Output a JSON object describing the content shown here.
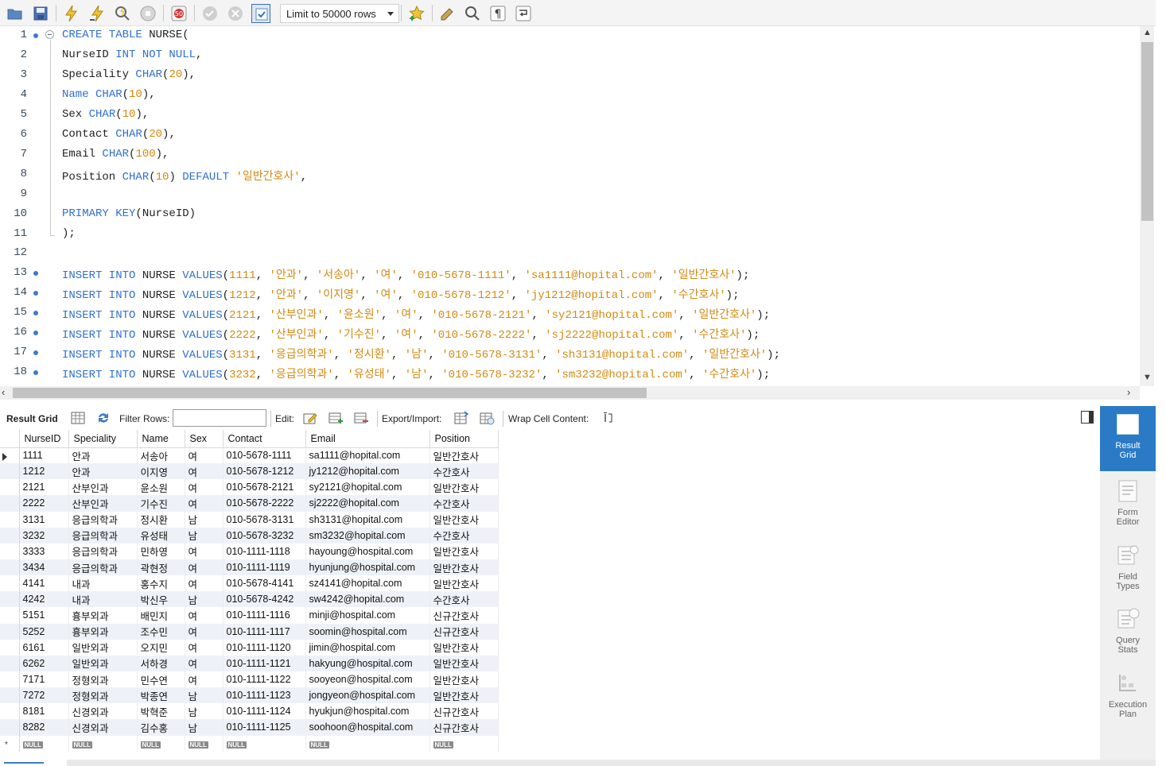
{
  "toolbar": {
    "limit_label": "Limit to 50000 rows",
    "icons": [
      "open-folder-icon",
      "save-icon",
      "execute-icon",
      "execute-current-icon",
      "explain-icon",
      "stop-icon",
      "stop-on-error-icon",
      "commit-icon",
      "rollback-icon",
      "autocommit-icon",
      "beautify-icon",
      "add-snippet-icon",
      "find-icon",
      "invisible-chars-icon",
      "wrap-icon"
    ]
  },
  "editor": {
    "lines": [
      {
        "n": "1",
        "dot": true,
        "tokens": [
          {
            "t": "CREATE TABLE ",
            "c": "kw"
          },
          {
            "t": "NURSE(",
            "c": ""
          }
        ]
      },
      {
        "n": "2",
        "dot": false,
        "tokens": [
          {
            "t": "NurseID ",
            "c": ""
          },
          {
            "t": "INT NOT NULL",
            "c": "kw"
          },
          {
            "t": ",",
            "c": ""
          }
        ]
      },
      {
        "n": "3",
        "dot": false,
        "tokens": [
          {
            "t": "Speciality ",
            "c": ""
          },
          {
            "t": "CHAR",
            "c": "kw"
          },
          {
            "t": "(",
            "c": ""
          },
          {
            "t": "20",
            "c": "num"
          },
          {
            "t": "),",
            "c": ""
          }
        ]
      },
      {
        "n": "4",
        "dot": false,
        "tokens": [
          {
            "t": "Name ",
            "c": "kw"
          },
          {
            "t": "CHAR",
            "c": "kw"
          },
          {
            "t": "(",
            "c": ""
          },
          {
            "t": "10",
            "c": "num"
          },
          {
            "t": "),",
            "c": ""
          }
        ]
      },
      {
        "n": "5",
        "dot": false,
        "tokens": [
          {
            "t": "Sex ",
            "c": ""
          },
          {
            "t": "CHAR",
            "c": "kw"
          },
          {
            "t": "(",
            "c": ""
          },
          {
            "t": "10",
            "c": "num"
          },
          {
            "t": "),",
            "c": ""
          }
        ]
      },
      {
        "n": "6",
        "dot": false,
        "tokens": [
          {
            "t": "Contact ",
            "c": ""
          },
          {
            "t": "CHAR",
            "c": "kw"
          },
          {
            "t": "(",
            "c": ""
          },
          {
            "t": "20",
            "c": "num"
          },
          {
            "t": "),",
            "c": ""
          }
        ]
      },
      {
        "n": "7",
        "dot": false,
        "tokens": [
          {
            "t": "Email ",
            "c": ""
          },
          {
            "t": "CHAR",
            "c": "kw"
          },
          {
            "t": "(",
            "c": ""
          },
          {
            "t": "100",
            "c": "num"
          },
          {
            "t": "),",
            "c": ""
          }
        ]
      },
      {
        "n": "8",
        "dot": false,
        "tokens": [
          {
            "t": "Position ",
            "c": ""
          },
          {
            "t": "CHAR",
            "c": "kw"
          },
          {
            "t": "(",
            "c": ""
          },
          {
            "t": "10",
            "c": "num"
          },
          {
            "t": ") ",
            "c": ""
          },
          {
            "t": "DEFAULT ",
            "c": "kw"
          },
          {
            "t": "'일반간호사'",
            "c": "str"
          },
          {
            "t": ",",
            "c": ""
          }
        ]
      },
      {
        "n": "9",
        "dot": false,
        "tokens": []
      },
      {
        "n": "10",
        "dot": false,
        "tokens": [
          {
            "t": "PRIMARY KEY",
            "c": "kw"
          },
          {
            "t": "(NurseID)",
            "c": ""
          }
        ]
      },
      {
        "n": "11",
        "dot": false,
        "tokens": [
          {
            "t": ");",
            "c": ""
          }
        ]
      },
      {
        "n": "12",
        "dot": false,
        "tokens": []
      },
      {
        "n": "13",
        "dot": true,
        "tokens": [
          {
            "t": "INSERT INTO ",
            "c": "kw"
          },
          {
            "t": "NURSE ",
            "c": ""
          },
          {
            "t": "VALUES",
            "c": "kw"
          },
          {
            "t": "(",
            "c": ""
          },
          {
            "t": "1111",
            "c": "num"
          },
          {
            "t": ", ",
            "c": ""
          },
          {
            "t": "'안과'",
            "c": "str"
          },
          {
            "t": ", ",
            "c": ""
          },
          {
            "t": "'서송아'",
            "c": "str"
          },
          {
            "t": ", ",
            "c": ""
          },
          {
            "t": "'여'",
            "c": "str"
          },
          {
            "t": ", ",
            "c": ""
          },
          {
            "t": "'010-5678-1111'",
            "c": "str"
          },
          {
            "t": ", ",
            "c": ""
          },
          {
            "t": "'sa1111@hopital.com'",
            "c": "str"
          },
          {
            "t": ", ",
            "c": ""
          },
          {
            "t": "'일반간호사'",
            "c": "str"
          },
          {
            "t": ");",
            "c": ""
          }
        ]
      },
      {
        "n": "14",
        "dot": true,
        "tokens": [
          {
            "t": "INSERT INTO ",
            "c": "kw"
          },
          {
            "t": "NURSE ",
            "c": ""
          },
          {
            "t": "VALUES",
            "c": "kw"
          },
          {
            "t": "(",
            "c": ""
          },
          {
            "t": "1212",
            "c": "num"
          },
          {
            "t": ", ",
            "c": ""
          },
          {
            "t": "'안과'",
            "c": "str"
          },
          {
            "t": ", ",
            "c": ""
          },
          {
            "t": "'이지영'",
            "c": "str"
          },
          {
            "t": ", ",
            "c": ""
          },
          {
            "t": "'여'",
            "c": "str"
          },
          {
            "t": ", ",
            "c": ""
          },
          {
            "t": "'010-5678-1212'",
            "c": "str"
          },
          {
            "t": ", ",
            "c": ""
          },
          {
            "t": "'jy1212@hopital.com'",
            "c": "str"
          },
          {
            "t": ", ",
            "c": ""
          },
          {
            "t": "'수간호사'",
            "c": "str"
          },
          {
            "t": ");",
            "c": ""
          }
        ]
      },
      {
        "n": "15",
        "dot": true,
        "tokens": [
          {
            "t": "INSERT INTO ",
            "c": "kw"
          },
          {
            "t": "NURSE ",
            "c": ""
          },
          {
            "t": "VALUES",
            "c": "kw"
          },
          {
            "t": "(",
            "c": ""
          },
          {
            "t": "2121",
            "c": "num"
          },
          {
            "t": ", ",
            "c": ""
          },
          {
            "t": "'산부인과'",
            "c": "str"
          },
          {
            "t": ", ",
            "c": ""
          },
          {
            "t": "'윤소원'",
            "c": "str"
          },
          {
            "t": ", ",
            "c": ""
          },
          {
            "t": "'여'",
            "c": "str"
          },
          {
            "t": ", ",
            "c": ""
          },
          {
            "t": "'010-5678-2121'",
            "c": "str"
          },
          {
            "t": ", ",
            "c": ""
          },
          {
            "t": "'sy2121@hopital.com'",
            "c": "str"
          },
          {
            "t": ", ",
            "c": ""
          },
          {
            "t": "'일반간호사'",
            "c": "str"
          },
          {
            "t": ");",
            "c": ""
          }
        ]
      },
      {
        "n": "16",
        "dot": true,
        "tokens": [
          {
            "t": "INSERT INTO ",
            "c": "kw"
          },
          {
            "t": "NURSE ",
            "c": ""
          },
          {
            "t": "VALUES",
            "c": "kw"
          },
          {
            "t": "(",
            "c": ""
          },
          {
            "t": "2222",
            "c": "num"
          },
          {
            "t": ", ",
            "c": ""
          },
          {
            "t": "'산부인과'",
            "c": "str"
          },
          {
            "t": ", ",
            "c": ""
          },
          {
            "t": "'기수진'",
            "c": "str"
          },
          {
            "t": ", ",
            "c": ""
          },
          {
            "t": "'여'",
            "c": "str"
          },
          {
            "t": ", ",
            "c": ""
          },
          {
            "t": "'010-5678-2222'",
            "c": "str"
          },
          {
            "t": ", ",
            "c": ""
          },
          {
            "t": "'sj2222@hopital.com'",
            "c": "str"
          },
          {
            "t": ", ",
            "c": ""
          },
          {
            "t": "'수간호사'",
            "c": "str"
          },
          {
            "t": ");",
            "c": ""
          }
        ]
      },
      {
        "n": "17",
        "dot": true,
        "tokens": [
          {
            "t": "INSERT INTO ",
            "c": "kw"
          },
          {
            "t": "NURSE ",
            "c": ""
          },
          {
            "t": "VALUES",
            "c": "kw"
          },
          {
            "t": "(",
            "c": ""
          },
          {
            "t": "3131",
            "c": "num"
          },
          {
            "t": ", ",
            "c": ""
          },
          {
            "t": "'응급의학과'",
            "c": "str"
          },
          {
            "t": ", ",
            "c": ""
          },
          {
            "t": "'정시환'",
            "c": "str"
          },
          {
            "t": ", ",
            "c": ""
          },
          {
            "t": "'남'",
            "c": "str"
          },
          {
            "t": ", ",
            "c": ""
          },
          {
            "t": "'010-5678-3131'",
            "c": "str"
          },
          {
            "t": ", ",
            "c": ""
          },
          {
            "t": "'sh3131@hopital.com'",
            "c": "str"
          },
          {
            "t": ", ",
            "c": ""
          },
          {
            "t": "'일반간호사'",
            "c": "str"
          },
          {
            "t": ");",
            "c": ""
          }
        ]
      },
      {
        "n": "18",
        "dot": true,
        "tokens": [
          {
            "t": "INSERT INTO ",
            "c": "kw"
          },
          {
            "t": "NURSE ",
            "c": ""
          },
          {
            "t": "VALUES",
            "c": "kw"
          },
          {
            "t": "(",
            "c": ""
          },
          {
            "t": "3232",
            "c": "num"
          },
          {
            "t": ", ",
            "c": ""
          },
          {
            "t": "'응급의학과'",
            "c": "str"
          },
          {
            "t": ", ",
            "c": ""
          },
          {
            "t": "'유성태'",
            "c": "str"
          },
          {
            "t": ", ",
            "c": ""
          },
          {
            "t": "'남'",
            "c": "str"
          },
          {
            "t": ", ",
            "c": ""
          },
          {
            "t": "'010-5678-3232'",
            "c": "str"
          },
          {
            "t": ", ",
            "c": ""
          },
          {
            "t": "'sm3232@hopital.com'",
            "c": "str"
          },
          {
            "t": ", ",
            "c": ""
          },
          {
            "t": "'수간호사'",
            "c": "str"
          },
          {
            "t": ");",
            "c": ""
          }
        ]
      }
    ]
  },
  "result_toolbar": {
    "result_grid_label": "Result Grid",
    "filter_rows_label": "Filter Rows:",
    "filter_value": "",
    "edit_label": "Edit:",
    "export_import_label": "Export/Import:",
    "wrap_label": "Wrap Cell Content:"
  },
  "grid": {
    "columns": [
      "NurseID",
      "Speciality",
      "Name",
      "Sex",
      "Contact",
      "Email",
      "Position"
    ],
    "rows": [
      [
        "1111",
        "안과",
        "서송아",
        "여",
        "010-5678-1111",
        "sa1111@hopital.com",
        "일반간호사"
      ],
      [
        "1212",
        "안과",
        "이지영",
        "여",
        "010-5678-1212",
        "jy1212@hopital.com",
        "수간호사"
      ],
      [
        "2121",
        "산부인과",
        "윤소원",
        "여",
        "010-5678-2121",
        "sy2121@hopital.com",
        "일반간호사"
      ],
      [
        "2222",
        "산부인과",
        "기수진",
        "여",
        "010-5678-2222",
        "sj2222@hopital.com",
        "수간호사"
      ],
      [
        "3131",
        "응급의학과",
        "정시환",
        "남",
        "010-5678-3131",
        "sh3131@hopital.com",
        "일반간호사"
      ],
      [
        "3232",
        "응급의학과",
        "유성태",
        "남",
        "010-5678-3232",
        "sm3232@hopital.com",
        "수간호사"
      ],
      [
        "3333",
        "응급의학과",
        "민하영",
        "여",
        "010-1111-1118",
        "hayoung@hospital.com",
        "일반간호사"
      ],
      [
        "3434",
        "응급의학과",
        "곽현정",
        "여",
        "010-1111-1119",
        "hyunjung@hospital.com",
        "일반간호사"
      ],
      [
        "4141",
        "내과",
        "홍수지",
        "여",
        "010-5678-4141",
        "sz4141@hopital.com",
        "일반간호사"
      ],
      [
        "4242",
        "내과",
        "박신우",
        "남",
        "010-5678-4242",
        "sw4242@hopital.com",
        "수간호사"
      ],
      [
        "5151",
        "흉부외과",
        "배민지",
        "여",
        "010-1111-1116",
        "minji@hospital.com",
        "신규간호사"
      ],
      [
        "5252",
        "흉부외과",
        "조수민",
        "여",
        "010-1111-1117",
        "soomin@hospital.com",
        "신규간호사"
      ],
      [
        "6161",
        "일반외과",
        "오지민",
        "여",
        "010-1111-1120",
        "jimin@hospital.com",
        "일반간호사"
      ],
      [
        "6262",
        "일반외과",
        "서하경",
        "여",
        "010-1111-1121",
        "hakyung@hospital.com",
        "일반간호사"
      ],
      [
        "7171",
        "정형외과",
        "민수연",
        "여",
        "010-1111-1122",
        "sooyeon@hospital.com",
        "일반간호사"
      ],
      [
        "7272",
        "정형외과",
        "박종연",
        "남",
        "010-1111-1123",
        "jongyeon@hospital.com",
        "일반간호사"
      ],
      [
        "8181",
        "신경외과",
        "박혁준",
        "남",
        "010-1111-1124",
        "hyukjun@hospital.com",
        "신규간호사"
      ],
      [
        "8282",
        "신경외과",
        "김수홍",
        "남",
        "010-1111-1125",
        "soohoon@hospital.com",
        "신규간호사"
      ]
    ],
    "null_label": "NULL",
    "new_row_marker": "*"
  },
  "side_panel": {
    "buttons": [
      {
        "label1": "Result",
        "label2": "Grid",
        "active": true,
        "icon": "result-grid-icon"
      },
      {
        "label1": "Form",
        "label2": "Editor",
        "active": false,
        "icon": "form-editor-icon"
      },
      {
        "label1": "Field",
        "label2": "Types",
        "active": false,
        "icon": "field-types-icon"
      },
      {
        "label1": "Query",
        "label2": "Stats",
        "active": false,
        "icon": "query-stats-icon"
      },
      {
        "label1": "Execution",
        "label2": "Plan",
        "active": false,
        "icon": "execution-plan-icon"
      }
    ]
  },
  "colors": {
    "keyword": "#2f6fd1",
    "string": "#d38a10",
    "accent": "#2a7ac6"
  }
}
